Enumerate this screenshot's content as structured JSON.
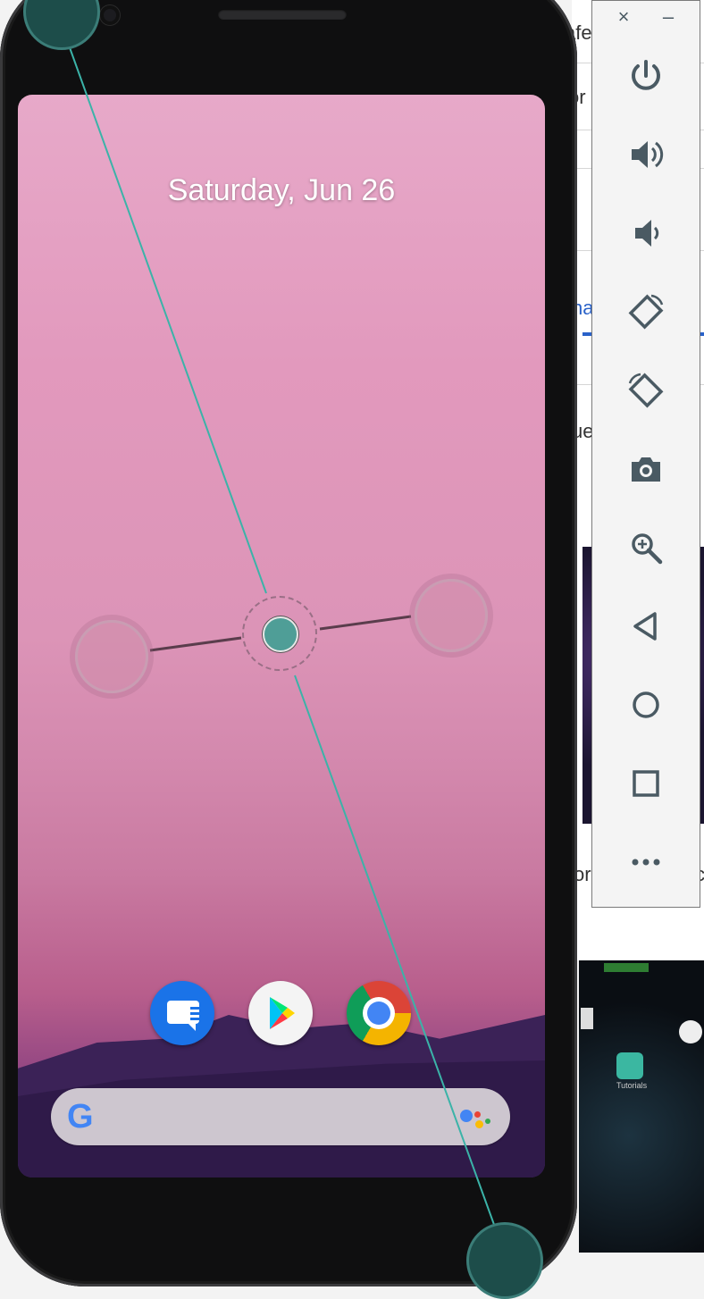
{
  "lock_screen": {
    "date": "Saturday, Jun 26"
  },
  "dock": {
    "apps": [
      {
        "name": "Messages",
        "icon": "messages-icon"
      },
      {
        "name": "Play Store",
        "icon": "play-store-icon"
      },
      {
        "name": "Chrome",
        "icon": "chrome-icon"
      }
    ]
  },
  "search_bar": {
    "logo": "G",
    "assistant_icon": "google-assistant-icon"
  },
  "emulator_toolbar": {
    "close": "×",
    "minimize": "–",
    "buttons": [
      {
        "id": "power",
        "icon": "power-icon"
      },
      {
        "id": "volume-up",
        "icon": "volume-up-icon"
      },
      {
        "id": "volume-down",
        "icon": "volume-down-icon"
      },
      {
        "id": "rotate-left",
        "icon": "rotate-left-icon"
      },
      {
        "id": "rotate-right",
        "icon": "rotate-right-icon"
      },
      {
        "id": "screenshot",
        "icon": "camera-icon"
      },
      {
        "id": "zoom",
        "icon": "zoom-in-icon"
      },
      {
        "id": "back",
        "icon": "back-icon"
      },
      {
        "id": "home",
        "icon": "home-icon"
      },
      {
        "id": "overview",
        "icon": "overview-icon"
      },
      {
        "id": "more",
        "icon": "more-icon"
      }
    ]
  },
  "background_fragments": {
    "a": "afe",
    "b": "or",
    "c": "na",
    "d": "ue",
    "e": "or",
    "f": "c",
    "g": "Tutorials"
  },
  "colors": {
    "overlay_accent": "#3bb3a8",
    "toolbar_icon": "#4a5a63"
  }
}
